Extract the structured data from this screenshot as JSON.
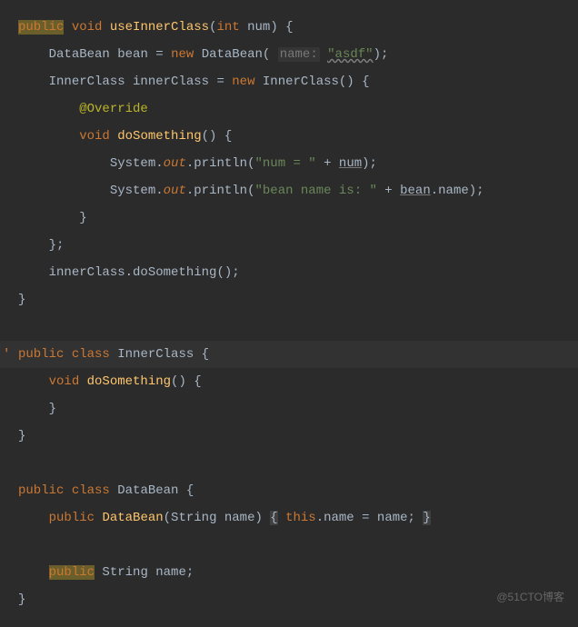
{
  "code": {
    "l1": {
      "public": "public",
      "void": "void",
      "method": "useInnerClass",
      "int": "int",
      "param": "num",
      "rest": ") {"
    },
    "l2": {
      "type": "DataBean",
      "var": "bean",
      "eq": " = ",
      "new": "new",
      "ctor": "DataBean",
      "hint": "name:",
      "str": "\"asdf\"",
      "end": ");"
    },
    "l3": {
      "type": "InnerClass",
      "var": "innerClass",
      "eq": " = ",
      "new": "new",
      "ctor": "InnerClass",
      "rest": "() {"
    },
    "l4": {
      "anno": "@Override"
    },
    "l5": {
      "void": "void",
      "method": "doSomething",
      "rest": "() {"
    },
    "l6": {
      "sys": "System.",
      "out": "out",
      "dot": ".println(",
      "str": "\"num = \"",
      "plus": " + ",
      "var": "num",
      "end": ");"
    },
    "l7": {
      "sys": "System.",
      "out": "out",
      "dot": ".println(",
      "str": "\"bean name is: \"",
      "plus": " + ",
      "var": "bean",
      "field": ".name);"
    },
    "l8": {
      "brace": "}"
    },
    "l9": {
      "brace": "};"
    },
    "l10": {
      "call": "innerClass.doSomething();"
    },
    "l11": {
      "brace": "}"
    },
    "l12": {
      "public": "public",
      "class": "class",
      "name": "InnerClass",
      "rest": " {"
    },
    "l13": {
      "void": "void",
      "method": "doSomething",
      "rest": "() {"
    },
    "l14": {
      "brace": "}"
    },
    "l15": {
      "brace": "}"
    },
    "l16": {
      "public": "public",
      "class": "class",
      "name": "DataBean",
      "rest": " {"
    },
    "l17": {
      "public": "public",
      "ctor": "DataBean",
      "params": "(String name) ",
      "lb": "{",
      "sp": " ",
      "this": "this",
      "assign": ".name = name; ",
      "rb": "}"
    },
    "l18": {
      "public": "public",
      "type": " String name;"
    },
    "l19": {
      "brace": "}"
    }
  },
  "watermark": "@51CTO博客"
}
